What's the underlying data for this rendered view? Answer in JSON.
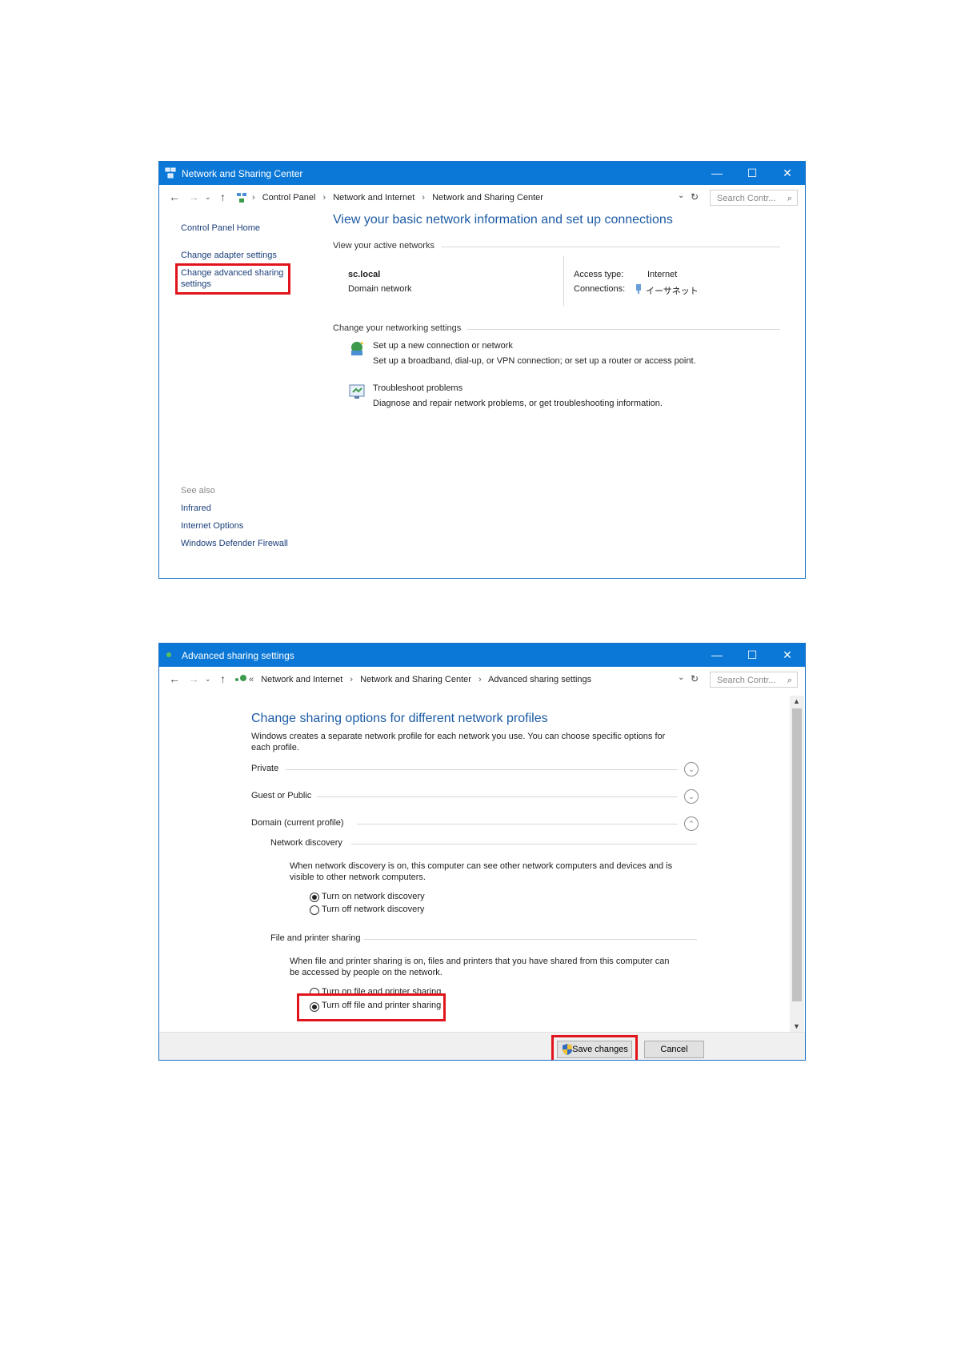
{
  "window1": {
    "title": "Network and Sharing Center",
    "window_controls": {
      "minimize": "—",
      "maximize": "☐",
      "close": "✕"
    },
    "breadcrumb": [
      "Control Panel",
      "Network and Internet",
      "Network and Sharing Center"
    ],
    "search_placeholder": "Search Contr...",
    "left_links": {
      "home": "Control Panel Home",
      "adapter": "Change adapter settings",
      "advanced_line1": "Change advanced sharing",
      "advanced_line2": "settings"
    },
    "see_also": {
      "label": "See also",
      "items": [
        "Infrared",
        "Internet Options",
        "Windows Defender Firewall"
      ]
    },
    "heading": "View your basic network information and set up connections",
    "active_networks_label": "View your active networks",
    "network": {
      "name": "sc.local",
      "type": "Domain network",
      "access_type_label": "Access type:",
      "access_type_value": "Internet",
      "connections_label": "Connections:",
      "connections_value": "イーサネット"
    },
    "change_settings_label": "Change your networking settings",
    "tasks": [
      {
        "link": "Set up a new connection or network",
        "desc": "Set up a broadband, dial-up, or VPN connection; or set up a router or access point."
      },
      {
        "link": "Troubleshoot problems",
        "desc": "Diagnose and repair network problems, or get troubleshooting information."
      }
    ]
  },
  "window2": {
    "title": "Advanced sharing settings",
    "window_controls": {
      "minimize": "—",
      "maximize": "☐",
      "close": "✕"
    },
    "breadcrumb_prefix": "«",
    "breadcrumb": [
      "Network and Internet",
      "Network and Sharing Center",
      "Advanced sharing settings"
    ],
    "search_placeholder": "Search Contr...",
    "heading": "Change sharing options for different network profiles",
    "intro_line1": "Windows creates a separate network profile for each network you use. You can choose specific options for",
    "intro_line2": "each profile.",
    "profiles": [
      "Private",
      "Guest or Public",
      "Domain (current profile)"
    ],
    "network_discovery": {
      "label": "Network discovery",
      "desc_line1": "When network discovery is on, this computer can see other network computers and devices and is",
      "desc_line2": "visible to other network computers.",
      "options": [
        "Turn on network discovery",
        "Turn off network discovery"
      ],
      "selected": 0
    },
    "file_sharing": {
      "label": "File and printer sharing",
      "desc_line1": "When file and printer sharing is on, files and printers that you have shared from this computer can",
      "desc_line2": "be accessed by people on the network.",
      "options": [
        "Turn on file and printer sharing",
        "Turn off file and printer sharing"
      ],
      "selected": 1
    },
    "buttons": {
      "save": "Save changes",
      "cancel": "Cancel"
    }
  },
  "colors": {
    "titlebar": "#0b78d7",
    "link": "#1a5ca8",
    "heading": "#1c5ba5",
    "highlight": "#e1141b"
  }
}
